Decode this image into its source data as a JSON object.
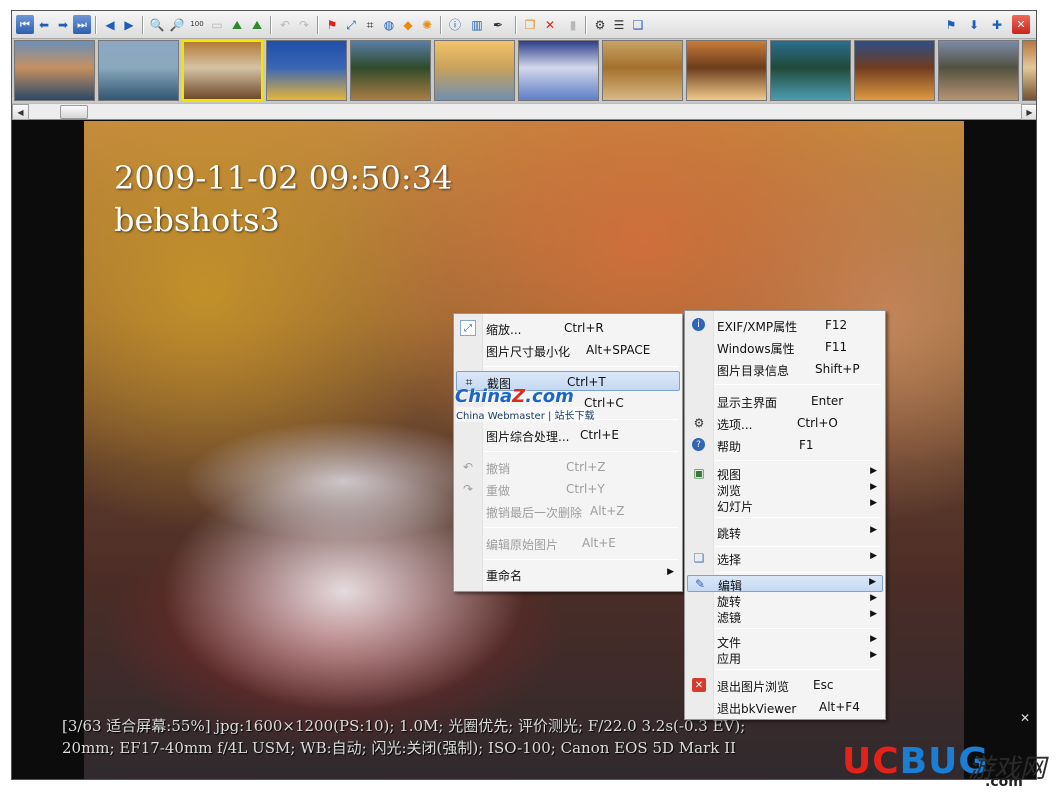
{
  "toolbar": {
    "icons": [
      "first-icon",
      "prev-icon",
      "next-icon",
      "last-icon",
      "back-icon",
      "forward-icon",
      "zoom-in-icon",
      "zoom-out-icon",
      "actual-size-icon",
      "fit-screen-icon",
      "mountain-icon",
      "mountain-2-icon",
      "undo-icon",
      "redo-icon",
      "flag-icon",
      "resize-icon",
      "crop-icon",
      "globe-icon",
      "cube-icon",
      "sun-icon",
      "info-icon",
      "histogram-icon",
      "dropper-icon",
      "copy-icon",
      "delete-icon",
      "trash-icon",
      "gear-icon",
      "list-icon",
      "open-icon",
      "blue-flag-icon",
      "download-icon",
      "pin-icon",
      "close-icon"
    ],
    "labels": {
      "i100": "100",
      "info": "i"
    }
  },
  "thumbnails": {
    "selected_index": 2,
    "colors": [
      [
        "#6c8fb8",
        "#2b4968",
        "#c69060"
      ],
      [
        "#8ea7c4",
        "#315572",
        "#8aa9bd"
      ],
      [
        "#b27b36",
        "#6d4a2a",
        "#d5c3a5"
      ],
      [
        "#1f4fa7",
        "#e5b53a",
        "#3a66b7"
      ],
      [
        "#5a7ea8",
        "#ab7d45",
        "#2f4b2a"
      ],
      [
        "#f2c36b",
        "#6f8fb0",
        "#c9a25c"
      ],
      [
        "#2c3d8a",
        "#5e7fc7",
        "#d4d7ea"
      ],
      [
        "#c9a465",
        "#d7b984",
        "#a46f2c"
      ],
      [
        "#c87c39",
        "#f1c98d",
        "#6c3d1d"
      ],
      [
        "#2b6e8d",
        "#4c9db0",
        "#204a3a"
      ],
      [
        "#2e4e86",
        "#e09a41",
        "#703c1f"
      ],
      [
        "#7c8ba7",
        "#b79473",
        "#52513f"
      ],
      [
        "#b8773f",
        "#77502f",
        "#e3c896"
      ]
    ]
  },
  "photo": {
    "timestamp": "2009-11-02 09:50:34",
    "name": "bebshots3",
    "status_line1": "[3/63 适合屏幕:55%] jpg:1600×1200(PS:10); 1.0M; 光圈优先; 评价测光; F/22.0 3.2s(-0.3 EV);",
    "status_line2": "20mm; EF17-40mm f/4L USM; WB:自动; 闪光:关闭(强制); ISO-100; Canon EOS 5D Mark II"
  },
  "edit_menu": {
    "items": [
      {
        "label": "缩放...",
        "shortcut": "Ctrl+R",
        "icon": "zoom-icon"
      },
      {
        "label": "图片尺寸最小化",
        "shortcut": "Alt+SPACE"
      },
      {
        "label": "截图",
        "shortcut": "Ctrl+T",
        "icon": "crop-icon"
      },
      {
        "label": "",
        "shortcut": "Ctrl+C"
      },
      {
        "label": "图片综合处理...",
        "shortcut": "Ctrl+E"
      },
      {
        "label": "撤销",
        "shortcut": "Ctrl+Z",
        "icon": "undo-icon"
      },
      {
        "label": "重做",
        "shortcut": "Ctrl+Y",
        "icon": "redo-icon"
      },
      {
        "label": "撤销最后一次删除",
        "shortcut": "Alt+Z"
      },
      {
        "label": "编辑原始图片",
        "shortcut": "Alt+E"
      },
      {
        "label": "重命名",
        "shortcut": ""
      }
    ]
  },
  "main_menu": {
    "items": [
      {
        "label": "EXIF/XMP属性",
        "shortcut": "F12"
      },
      {
        "label": "Windows属性",
        "shortcut": "F11"
      },
      {
        "label": "图片目录信息",
        "shortcut": "Shift+P"
      },
      {
        "label": "显示主界面",
        "shortcut": "Enter"
      },
      {
        "label": "选项...",
        "shortcut": "Ctrl+O"
      },
      {
        "label": "帮助",
        "shortcut": "F1"
      },
      {
        "label": "视图",
        "shortcut": ""
      },
      {
        "label": "浏览",
        "shortcut": ""
      },
      {
        "label": "幻灯片",
        "shortcut": ""
      },
      {
        "label": "跳转",
        "shortcut": ""
      },
      {
        "label": "选择",
        "shortcut": ""
      },
      {
        "label": "编辑",
        "shortcut": ""
      },
      {
        "label": "旋转",
        "shortcut": ""
      },
      {
        "label": "滤镜",
        "shortcut": ""
      },
      {
        "label": "文件",
        "shortcut": ""
      },
      {
        "label": "应用",
        "shortcut": ""
      },
      {
        "label": "退出图片浏览",
        "shortcut": "Esc"
      },
      {
        "label": "退出bkViewer",
        "shortcut": "Alt+F4"
      }
    ]
  },
  "watermark": {
    "china": "China",
    "china_z": "Z",
    "china_com": ".com",
    "sub": "China Webmaster | 站长下载",
    "ucbug_u": "UC",
    "ucbug_o": "BUG",
    "cn": "游戏网",
    "com": ".com"
  }
}
